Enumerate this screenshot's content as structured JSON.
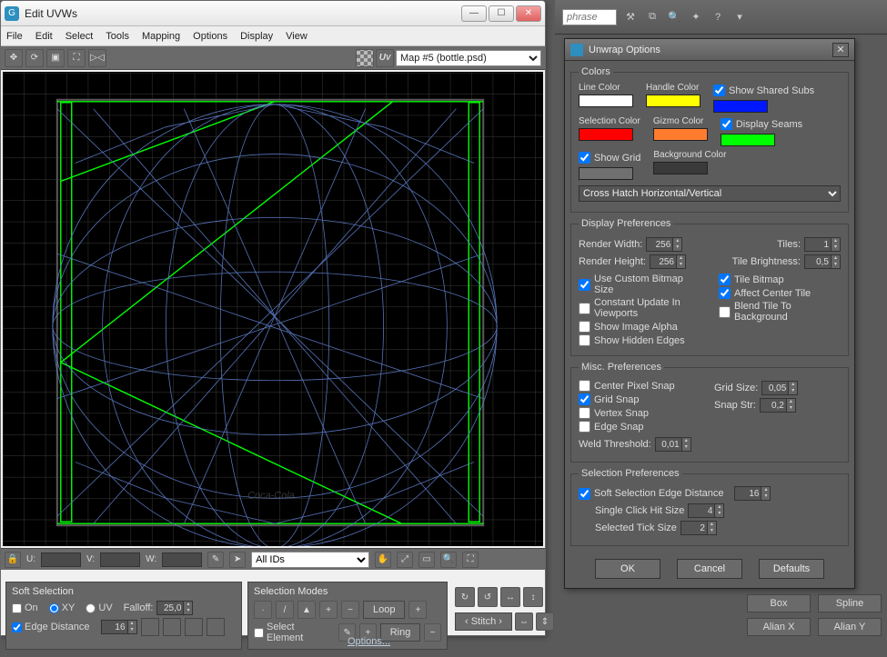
{
  "bg_toolbar": {
    "search_placeholder": "phrase"
  },
  "uv_window": {
    "title": "Edit UVWs",
    "menus": [
      "File",
      "Edit",
      "Select",
      "Tools",
      "Mapping",
      "Options",
      "Display",
      "View"
    ],
    "map_selector": "Map #5 (bottle.psd)",
    "coord_labels": {
      "u": "U:",
      "v": "V:",
      "w": "W:"
    },
    "ids_selector": "All IDs"
  },
  "soft_selection": {
    "title": "Soft Selection",
    "on": "On",
    "xy": "XY",
    "uv": "UV",
    "falloff_label": "Falloff:",
    "falloff": "25,0",
    "edge_distance": "Edge Distance",
    "edge_val": "16"
  },
  "selection_modes": {
    "title": "Selection Modes",
    "select_element": "Select Element",
    "loop": "Loop",
    "ring": "Ring",
    "stitch": "‹ Stitch ›"
  },
  "options_link": "Options...",
  "opt_window": {
    "title": "Unwrap Options",
    "colors": {
      "legend": "Colors",
      "line": "Line Color",
      "line_c": "#ffffff",
      "handle": "Handle Color",
      "handle_c": "#ffff00",
      "show_shared": "Show Shared Subs",
      "shared_c": "#0018ff",
      "sel": "Selection Color",
      "sel_c": "#ff0000",
      "gizmo": "Gizmo Color",
      "gizmo_c": "#ff7c2e",
      "seams": "Display Seams",
      "seams_c": "#00ff00",
      "show_grid": "Show Grid",
      "grid_c": "#707070",
      "bg": "Background Color",
      "bg_c": "#3a3a3a",
      "hatch": "Cross Hatch Horizontal/Vertical"
    },
    "display": {
      "legend": "Display Preferences",
      "rw": "Render Width:",
      "rw_v": "256",
      "rh": "Render Height:",
      "rh_v": "256",
      "tiles": "Tiles:",
      "tiles_v": "1",
      "tb": "Tile Brightness:",
      "tb_v": "0,5",
      "use_custom": "Use Custom Bitmap Size",
      "constant": "Constant Update In Viewports",
      "show_alpha": "Show Image Alpha",
      "show_hidden": "Show Hidden Edges",
      "tile_bitmap": "Tile Bitmap",
      "affect_center": "Affect Center Tile",
      "blend": "Blend Tile To Background"
    },
    "misc": {
      "legend": "Misc. Preferences",
      "cps": "Center Pixel Snap",
      "gs": "Grid Snap",
      "vs": "Vertex Snap",
      "es": "Edge Snap",
      "grid_size": "Grid Size:",
      "grid_size_v": "0,05",
      "snap_str": "Snap Str:",
      "snap_str_v": "0,2",
      "weld": "Weld Threshold:",
      "weld_v": "0,01"
    },
    "sel": {
      "legend": "Selection Preferences",
      "soft": "Soft Selection Edge Distance",
      "soft_v": "16",
      "single": "Single Click Hit Size",
      "single_v": "4",
      "tick": "Selected Tick Size",
      "tick_v": "2"
    },
    "buttons": {
      "ok": "OK",
      "cancel": "Cancel",
      "defaults": "Defaults"
    }
  },
  "side": {
    "box": "Box",
    "spline": "Spline",
    "alignx": "Alian X",
    "aligny": "Alian Y"
  }
}
